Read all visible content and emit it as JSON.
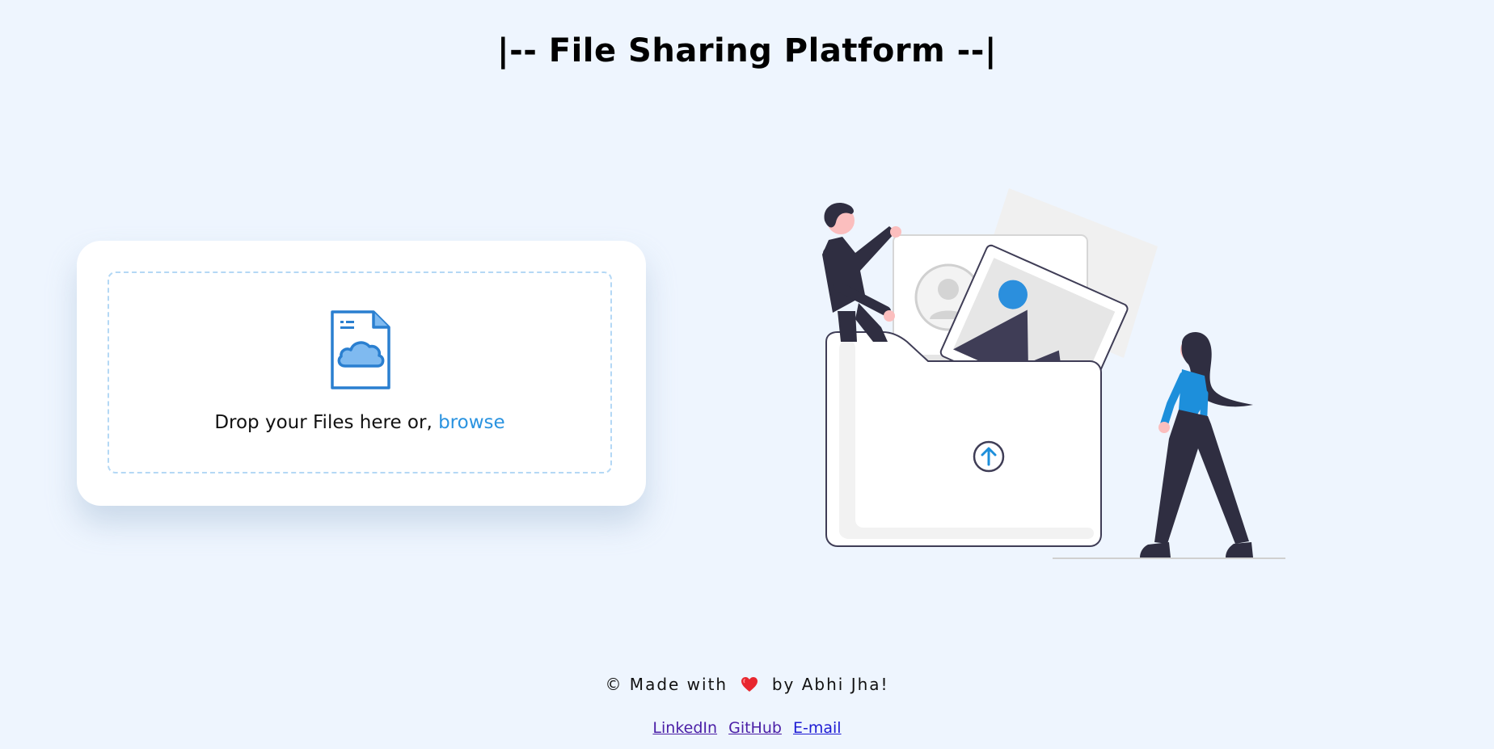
{
  "header": {
    "title": "|-- File Sharing Platform --|"
  },
  "upload": {
    "drop_text": "Drop your Files here or,",
    "browse_label": "browse",
    "icon": "cloud-file-icon"
  },
  "illustration": {
    "icon": "file-upload-illustration"
  },
  "footer": {
    "credit_prefix": "© Made with",
    "credit_suffix": "by Abhi Jha!",
    "heart_icon": "heart-icon",
    "links": [
      {
        "label": "LinkedIn"
      },
      {
        "label": "GitHub"
      },
      {
        "label": "E-mail"
      }
    ]
  },
  "colors": {
    "background": "#eef5fe",
    "accent": "#2a93e0",
    "dashed_border": "#b4d8f5"
  }
}
